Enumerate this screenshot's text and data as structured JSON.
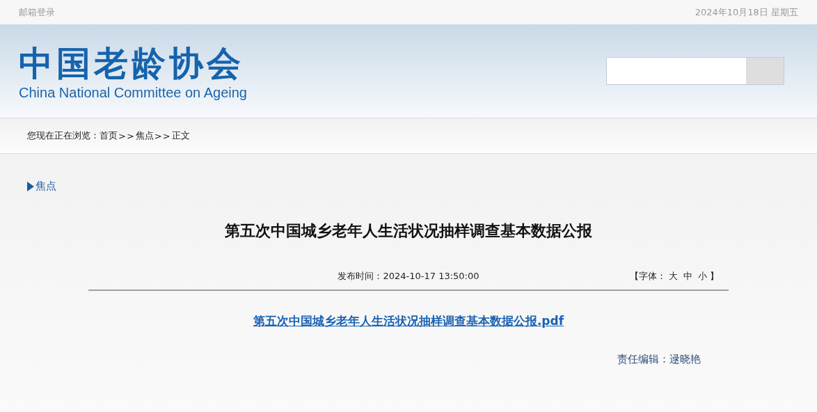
{
  "top_bar": {
    "mail_login": "邮箱登录",
    "date": "2024年10月18日 星期五"
  },
  "header": {
    "logo_title": "中国老龄协会",
    "logo_subtitle": "China National Committee on Ageing"
  },
  "breadcrumb": {
    "prefix": "您现在正在浏览：",
    "crumbs": [
      {
        "kind": "link",
        "label": "首页"
      },
      {
        "kind": "separator",
        "label": ">>"
      },
      {
        "kind": "link",
        "label": "焦点"
      },
      {
        "kind": "separator",
        "label": ">>"
      },
      {
        "kind": "current",
        "label": "正文"
      }
    ]
  },
  "section": {
    "label": "焦点"
  },
  "article": {
    "title": "第五次中国城乡老年人生活状况抽样调查基本数据公报",
    "publish_label": "发布时间：",
    "publish_time": "2024-10-17 13:50:00",
    "font_size": {
      "open": "【字体：",
      "options": [
        "大",
        "中",
        "小"
      ],
      "close": "】"
    },
    "attachment": "第五次中国城乡老年人生活状况抽样调查基本数据公报.pdf",
    "editor": "责任编辑：逯晓艳"
  }
}
